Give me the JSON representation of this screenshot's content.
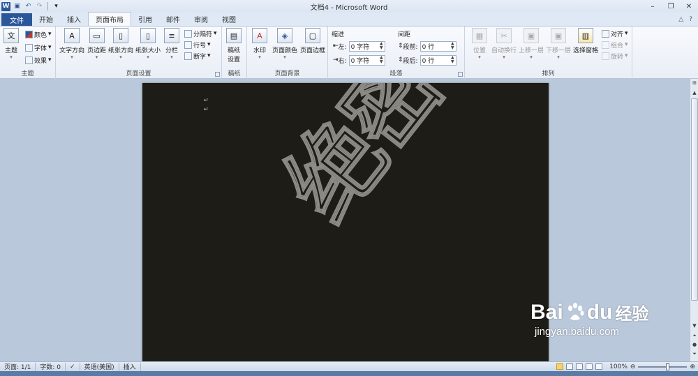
{
  "window": {
    "title": "文档4 - Microsoft Word"
  },
  "quick_access": {
    "icons": [
      "word-logo-icon",
      "save-icon",
      "undo-icon",
      "redo-icon",
      "customize-icon"
    ]
  },
  "tabs": [
    "文件",
    "开始",
    "插入",
    "页面布局",
    "引用",
    "邮件",
    "审阅",
    "视图"
  ],
  "active_tab": "页面布局",
  "ribbon": {
    "theme_group": {
      "label": "主题",
      "theme_button": "主题",
      "colors": "颜色",
      "fonts": "字体",
      "effects": "效果"
    },
    "page_setup_group": {
      "label": "页面设置",
      "text_direction": "文字方向",
      "margins": "页边距",
      "orientation": "纸张方向",
      "size": "纸张大小",
      "columns": "分栏",
      "breaks": "分隔符",
      "line_numbers": "行号",
      "hyphenation": "断字"
    },
    "manuscript_group": {
      "label": "稿纸",
      "button_line1": "稿纸",
      "button_line2": "设置"
    },
    "page_background_group": {
      "label": "页面背景",
      "watermark": "水印",
      "page_color": "页面颜色",
      "page_borders": "页面边框"
    },
    "paragraph_group": {
      "label": "段落",
      "indent_title": "缩进",
      "spacing_title": "间距",
      "left_label": "左:",
      "left_value": "0 字符",
      "right_label": "右:",
      "right_value": "0 字符",
      "before_label": "段前:",
      "before_value": "0 行",
      "after_label": "段后:",
      "after_value": "0 行"
    },
    "arrange_group": {
      "label": "排列",
      "position": "位置",
      "wrap_text": "自动换行",
      "bring_forward": "上移一层",
      "send_backward": "下移一层",
      "selection_pane": "选择窗格",
      "align": "对齐",
      "group": "组合",
      "rotate": "旋转"
    }
  },
  "document": {
    "paragraph_marks": [
      "↵",
      "↵"
    ],
    "watermark_text": "绝密",
    "page_color": "#1e1c16",
    "watermark_color": "#8c8b86"
  },
  "statusbar": {
    "page": "页面: 1/1",
    "words": "字数: 0",
    "language": "英语(美国)",
    "mode": "插入",
    "zoom": "100%"
  },
  "overlay": {
    "brand_left": "Bai",
    "brand_right": "du",
    "brand_cn": "经验",
    "url": "jingyan.baidu.com"
  }
}
